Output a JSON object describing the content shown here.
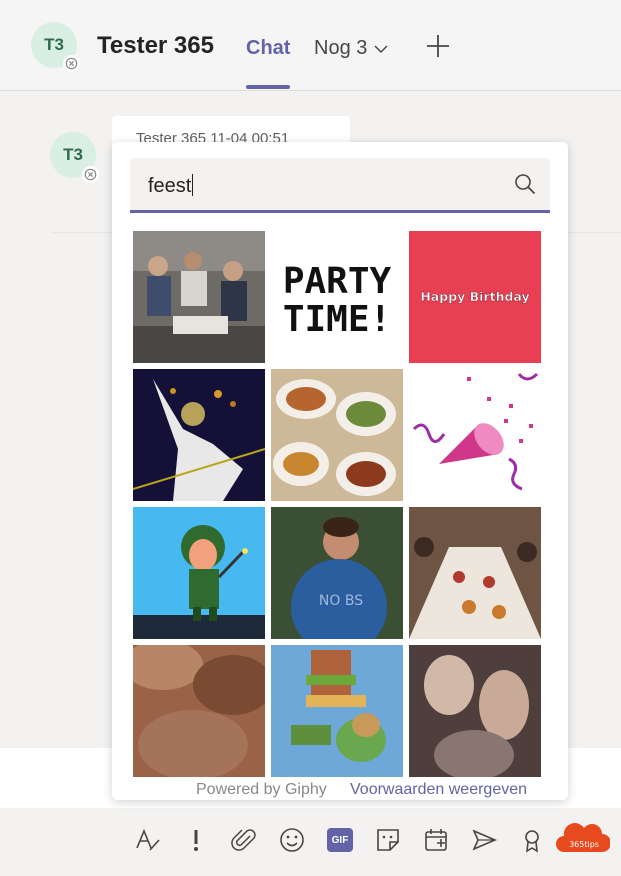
{
  "header": {
    "avatar_initials": "T3",
    "title": "Tester 365",
    "tabs": {
      "active": "Chat",
      "more": "Nog 3"
    }
  },
  "message": {
    "avatar_initials": "T3",
    "meta": "Tester 365   11-04 00:51"
  },
  "giphy": {
    "search_value": "feest",
    "tiles": [
      {
        "label": "crowd-dancing-gif"
      },
      {
        "label": "PARTY TIME!"
      },
      {
        "label": "Happy Birthday"
      },
      {
        "label": "cake-face-gif"
      },
      {
        "label": "buffet-dishes-gif"
      },
      {
        "label": "party-popper-gif"
      },
      {
        "label": "cartoon-soldier-gif"
      },
      {
        "label": "dancing-woman-gif"
      },
      {
        "label": "banquet-table-gif"
      },
      {
        "label": "blurry-crowd-gif"
      },
      {
        "label": "cartoon-sandwich-gif"
      },
      {
        "label": "party-people-gif"
      }
    ],
    "footer": {
      "powered": "Powered by Giphy",
      "terms": "Voorwaarden weergeven"
    }
  },
  "toolbar": {
    "icons": [
      "format-icon",
      "important-icon",
      "attach-icon",
      "emoji-icon",
      "gif-icon",
      "sticker-icon",
      "meeting-icon",
      "stream-icon",
      "praise-icon"
    ],
    "gif_label": "GIF",
    "badge": "365tips"
  },
  "colors": {
    "accent": "#6264a7",
    "background": "#f3f2f1",
    "avatar_bg": "#d9efe4",
    "badge": "#e8491d"
  }
}
